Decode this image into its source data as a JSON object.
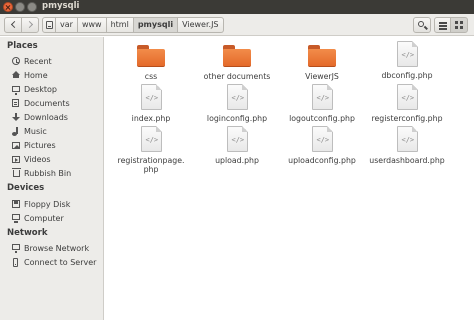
{
  "window": {
    "title": "pmysqli"
  },
  "breadcrumbs": [
    "var",
    "www",
    "html",
    "pmysqli",
    "Viewer.JS"
  ],
  "active_crumb": "pmysqli",
  "sidebar": {
    "places_label": "Places",
    "places": [
      {
        "label": "Recent",
        "icon": "clock-icon"
      },
      {
        "label": "Home",
        "icon": "home-icon"
      },
      {
        "label": "Desktop",
        "icon": "desktop-icon"
      },
      {
        "label": "Documents",
        "icon": "documents-icon"
      },
      {
        "label": "Downloads",
        "icon": "downloads-icon"
      },
      {
        "label": "Music",
        "icon": "music-icon"
      },
      {
        "label": "Pictures",
        "icon": "pictures-icon"
      },
      {
        "label": "Videos",
        "icon": "videos-icon"
      },
      {
        "label": "Rubbish Bin",
        "icon": "trash-icon"
      }
    ],
    "devices_label": "Devices",
    "devices": [
      {
        "label": "Floppy Disk",
        "icon": "floppy-icon"
      },
      {
        "label": "Computer",
        "icon": "computer-icon"
      }
    ],
    "network_label": "Network",
    "network": [
      {
        "label": "Browse Network",
        "icon": "network-icon"
      },
      {
        "label": "Connect to Server",
        "icon": "server-icon"
      }
    ]
  },
  "files": [
    {
      "name": "css",
      "kind": "folder"
    },
    {
      "name": "other documents",
      "kind": "folder"
    },
    {
      "name": "ViewerJS",
      "kind": "folder"
    },
    {
      "name": "dbconfig.php",
      "kind": "php"
    },
    {
      "name": "index.php",
      "kind": "php"
    },
    {
      "name": "loginconfig.php",
      "kind": "php"
    },
    {
      "name": "logoutconfig.php",
      "kind": "php"
    },
    {
      "name": "registerconfig.php",
      "kind": "php"
    },
    {
      "name": "registrationpage.\nphp",
      "kind": "php"
    },
    {
      "name": "upload.php",
      "kind": "php"
    },
    {
      "name": "uploadconfig.php",
      "kind": "php"
    },
    {
      "name": "userdashboard.php",
      "kind": "php"
    }
  ],
  "colors": {
    "titlebar": "#3b3a36",
    "folder_orange": "#e46a2a",
    "close_button": "#e9663a"
  }
}
